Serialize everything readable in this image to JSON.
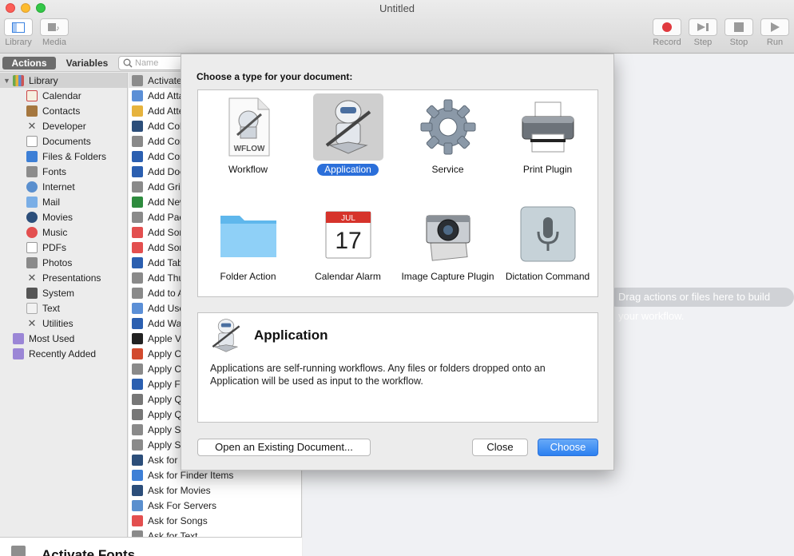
{
  "window": {
    "title": "Untitled"
  },
  "toolbar": {
    "library": "Library",
    "media": "Media",
    "record": "Record",
    "step": "Step",
    "stop": "Stop",
    "run": "Run"
  },
  "tabs": {
    "actions": "Actions",
    "variables": "Variables"
  },
  "search": {
    "placeholder": "Name"
  },
  "library": {
    "root": "Library",
    "items": [
      "Calendar",
      "Contacts",
      "Developer",
      "Documents",
      "Files & Folders",
      "Fonts",
      "Internet",
      "Mail",
      "Movies",
      "Music",
      "PDFs",
      "Photos",
      "Presentations",
      "System",
      "Text",
      "Utilities"
    ],
    "top": [
      "Most Used",
      "Recently Added"
    ]
  },
  "actions": [
    "Activate Fonts",
    "Add Attachments",
    "Add Attendees",
    "Add Color Profile",
    "Add Content",
    "Add Content to Documents",
    "Add Document Properties",
    "Add Grid",
    "Add New Sheet",
    "Add Packages",
    "Add Songs",
    "Add Songs to iPod",
    "Add Table",
    "Add Thumbnails",
    "Add to Album",
    "Add User Account",
    "Add Watermark",
    "Apple Versioning Tool",
    "Apply ColorSync Profile",
    "Apply Coreimage Filter",
    "Apply Font Format",
    "Apply Quartz Composition",
    "Apply Quartz Filter",
    "Apply SQL",
    "Apply System Configuration",
    "Ask for Confirmation",
    "Ask for Finder Items",
    "Ask for Movies",
    "Ask For Servers",
    "Ask for Songs",
    "Ask for Text"
  ],
  "action_description": {
    "title": "Activate Fonts"
  },
  "workflow_hint": "Drag actions or files here to build your workflow.",
  "sheet": {
    "heading": "Choose a type for your document:",
    "types": [
      {
        "label": "Workflow",
        "icon": "workflow-document-icon"
      },
      {
        "label": "Application",
        "icon": "automator-robot-icon",
        "selected": true
      },
      {
        "label": "Service",
        "icon": "gear-icon"
      },
      {
        "label": "Print Plugin",
        "icon": "printer-icon"
      },
      {
        "label": "Folder Action",
        "icon": "folder-icon"
      },
      {
        "label": "Calendar Alarm",
        "icon": "calendar-icon"
      },
      {
        "label": "Image Capture Plugin",
        "icon": "camera-icon"
      },
      {
        "label": "Dictation Command",
        "icon": "microphone-icon"
      }
    ],
    "wflow_badge": "WFLOW",
    "calendar_month": "JUL",
    "calendar_day": "17",
    "detail_title": "Application",
    "detail_text": "Applications are self-running workflows. Any files or folders dropped onto an Application will be used as input to the workflow.",
    "open_existing": "Open an Existing Document...",
    "close": "Close",
    "choose": "Choose"
  },
  "colors": {
    "accent": "#2b6fda",
    "record": "#e0393e"
  }
}
